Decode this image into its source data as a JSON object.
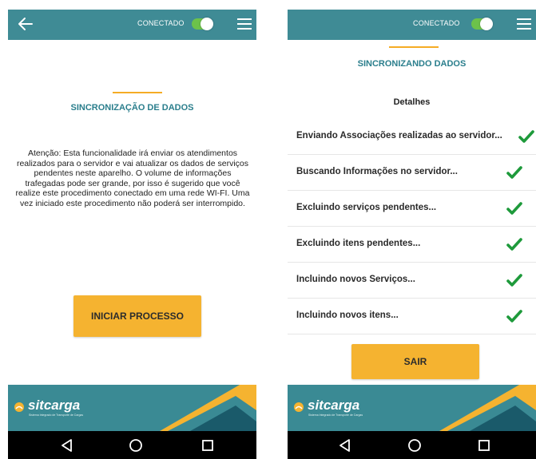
{
  "left_screen": {
    "status": {
      "label": "CONECTADO",
      "toggle_on": true
    },
    "title": "SINCRONIZAÇÃO DE DADOS",
    "warning_lines": [
      "Atenção: Esta funcionalidade irá enviar os atendimentos",
      "realizados para o servidor e vai atualizar os dados de serviços",
      "pendentes neste aparelho. O volume de informações",
      "trafegadas pode ser grande, por isso é sugerido que você",
      "realize este procedimento conectado em uma rede WI-FI. Uma",
      "vez iniciado este procedimento não poderá ser interrompido."
    ],
    "start_button": "INICIAR PROCESSO",
    "logo_text": "sitcarga",
    "logo_subtitle": "Sistema Integrado de Transporte de Cargas"
  },
  "right_screen": {
    "status": {
      "label": "CONECTADO",
      "toggle_on": true
    },
    "title": "SINCRONIZANDO DADOS",
    "details_heading": "Detalhes",
    "items": [
      {
        "label": "Enviando Associações realizadas ao servidor...",
        "done": true
      },
      {
        "label": "Buscando Informações no servidor...",
        "done": true
      },
      {
        "label": "Excluindo serviços pendentes...",
        "done": true
      },
      {
        "label": "Excluindo itens pendentes...",
        "done": true
      },
      {
        "label": "Incluindo novos Serviços...",
        "done": true
      },
      {
        "label": "Incluindo novos itens...",
        "done": true
      }
    ],
    "exit_button": "SAIR",
    "logo_text": "sitcarga",
    "logo_subtitle": "Sistema Integrado de Transporte de Cargas"
  },
  "colors": {
    "teal": "#3f8b95",
    "accent": "#f5b330",
    "check": "#1e9a3b",
    "title": "#2a7e8c"
  }
}
